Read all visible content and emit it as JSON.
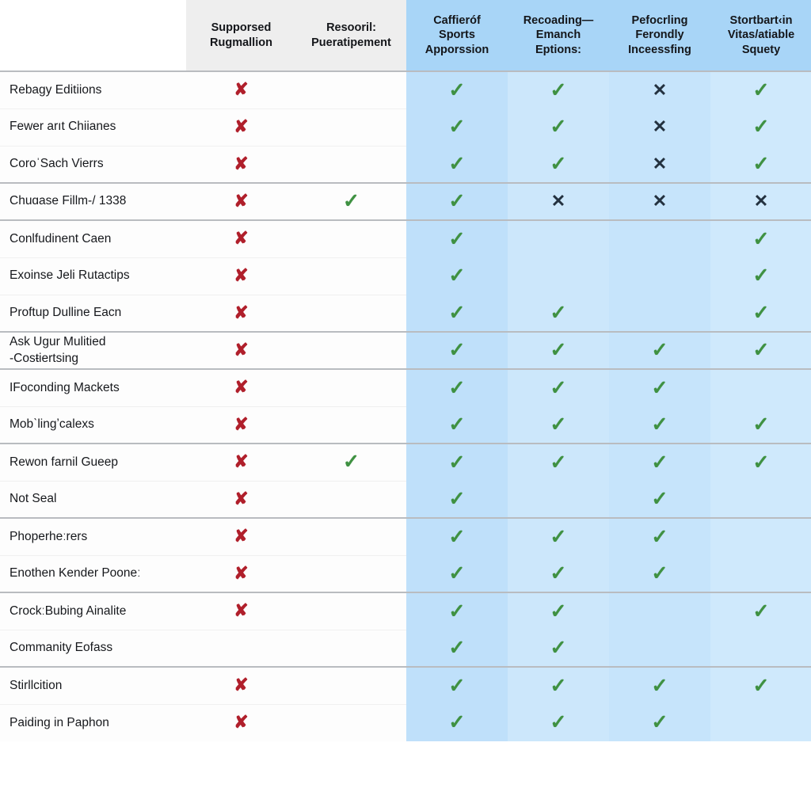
{
  "table": {
    "columns": [
      {
        "key": "label",
        "label": "",
        "style": "label"
      },
      {
        "key": "col1",
        "label": "Supporsed\nRugmallion",
        "style": "gray"
      },
      {
        "key": "col2",
        "label": "Resooril:\nPueratipement",
        "style": "gray"
      },
      {
        "key": "col3",
        "label": "Caffieróf\nSports\nApporssion",
        "style": "blue"
      },
      {
        "key": "col4",
        "label": "Recoading—\nEmanch Eptions:",
        "style": "blue"
      },
      {
        "key": "col5",
        "label": "Pefocrling\nFerondly\nInceessfing",
        "style": "blue"
      },
      {
        "key": "col6",
        "label": "Stortbart‹in\nVitas/atiable\nSquety",
        "style": "blue"
      }
    ],
    "marks": {
      "check": "✓",
      "x_red": "✘",
      "x_dark": "✕",
      "blank": ""
    },
    "colors": {
      "header_gray": "#eeeeee",
      "header_blue": "#a8d5f7",
      "body_blue": "#c9e6fb",
      "check_green": "#3f9142",
      "x_red": "#b01f2b",
      "x_dark": "#23313f",
      "divider": "#b9bcc0"
    },
    "groups": [
      {
        "id": "group-1",
        "rows": [
          {
            "label": "Rebagy Editiions",
            "cells": [
              "x_red",
              "blank",
              "check",
              "check",
              "x_dark",
              "check"
            ]
          },
          {
            "label": "Fewer arıt Chiianes",
            "cells": [
              "x_red",
              "blank",
              "check",
              "check",
              "x_dark",
              "check"
            ]
          },
          {
            "label": "CoroˈSach Vierrs",
            "cells": [
              "x_red",
              "blank",
              "check",
              "check",
              "x_dark",
              "check"
            ]
          }
        ]
      },
      {
        "id": "group-2",
        "rows": [
          {
            "label": "Chuɑase Fillm-/ 1338",
            "cells": [
              "x_red",
              "check",
              "check",
              "x_dark",
              "x_dark",
              "x_dark"
            ]
          }
        ]
      },
      {
        "id": "group-3",
        "rows": [
          {
            "label": "Conlfudinent Caen",
            "cells": [
              "x_red",
              "blank",
              "check",
              "blank",
              "blank",
              "check"
            ]
          },
          {
            "label": "Exoinse Jeli Rutactips",
            "cells": [
              "x_red",
              "blank",
              "check",
              "blank",
              "blank",
              "check"
            ]
          },
          {
            "label": "Proftup Dulline Eacn",
            "cells": [
              "x_red",
              "blank",
              "check",
              "check",
              "blank",
              "check"
            ]
          }
        ]
      },
      {
        "id": "group-4",
        "rows": [
          {
            "label": "Ask Ugur Mulitied\n-Cosŧiertsing",
            "cells": [
              "x_red",
              "blank",
              "check",
              "check",
              "check",
              "check"
            ]
          }
        ]
      },
      {
        "id": "group-5",
        "rows": [
          {
            "label": "IFoconding Mackets",
            "cells": [
              "x_red",
              "blank",
              "check",
              "check",
              "check",
              "blank"
            ]
          },
          {
            "label": "Mobˋlingʼcalexs",
            "cells": [
              "x_red",
              "blank",
              "check",
              "check",
              "check",
              "check"
            ]
          }
        ]
      },
      {
        "id": "group-6",
        "rows": [
          {
            "label": "Rewon farnil Gueep",
            "cells": [
              "x_red",
              "check",
              "check",
              "check",
              "check",
              "check"
            ]
          },
          {
            "label": "Not Seal",
            "cells": [
              "x_red",
              "blank",
              "check",
              "blank",
              "check",
              "blank"
            ]
          }
        ]
      },
      {
        "id": "group-7",
        "rows": [
          {
            "label": "Phoperheːrers",
            "cells": [
              "x_red",
              "blank",
              "check",
              "check",
              "check",
              "blank"
            ]
          },
          {
            "label": "Enothen Kender Pooneː",
            "cells": [
              "x_red",
              "blank",
              "check",
              "check",
              "check",
              "blank"
            ]
          }
        ]
      },
      {
        "id": "group-8",
        "rows": [
          {
            "label": "CrockːBubing Ainalite",
            "cells": [
              "x_red",
              "blank",
              "check",
              "check",
              "blank",
              "check"
            ]
          },
          {
            "label": "Commanity Eofass",
            "cells": [
              "blank",
              "blank",
              "check",
              "check",
              "blank",
              "blank"
            ]
          }
        ]
      },
      {
        "id": "group-9",
        "rows": [
          {
            "label": "Stirllcition",
            "cells": [
              "x_red",
              "blank",
              "check",
              "check",
              "check",
              "check"
            ]
          },
          {
            "label": "Paiding in Paphon",
            "cells": [
              "x_red",
              "blank",
              "check",
              "check",
              "check",
              "blank"
            ]
          }
        ]
      }
    ]
  }
}
